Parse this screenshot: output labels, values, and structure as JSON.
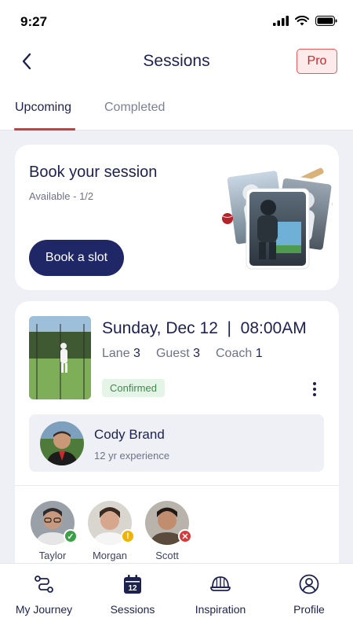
{
  "status_bar": {
    "time": "9:27"
  },
  "header": {
    "title": "Sessions",
    "pro_label": "Pro"
  },
  "tabs": [
    {
      "label": "Upcoming",
      "active": true
    },
    {
      "label": "Completed",
      "active": false
    }
  ],
  "book_card": {
    "title": "Book your session",
    "availability": "Available - 1/2",
    "button_label": "Book a slot"
  },
  "session": {
    "date_time": "Sunday, Dec 12  |  08:00AM",
    "lane_label": "Lane",
    "lane_value": "3",
    "guest_label": "Guest",
    "guest_value": "3",
    "coach_label": "Coach",
    "coach_value": "1",
    "status": "Confirmed",
    "coach": {
      "name": "Cody Brand",
      "experience": "12 yr experience"
    },
    "guests": [
      {
        "name": "Taylor",
        "status": "confirmed",
        "status_color": "#3aa14a"
      },
      {
        "name": "Morgan",
        "status": "pending",
        "status_color": "#f0b400"
      },
      {
        "name": "Scott",
        "status": "declined",
        "status_color": "#d63a3a"
      }
    ]
  },
  "bottom_nav": [
    {
      "label": "My Journey",
      "icon": "journey-icon"
    },
    {
      "label": "Sessions",
      "icon": "calendar-icon",
      "calendar_day": "12"
    },
    {
      "label": "Inspiration",
      "icon": "cap-icon"
    },
    {
      "label": "Profile",
      "icon": "profile-icon"
    }
  ],
  "colors": {
    "accent": "#d23a3a",
    "primary": "#1f2766",
    "confirmed": "#3f8a4a"
  }
}
